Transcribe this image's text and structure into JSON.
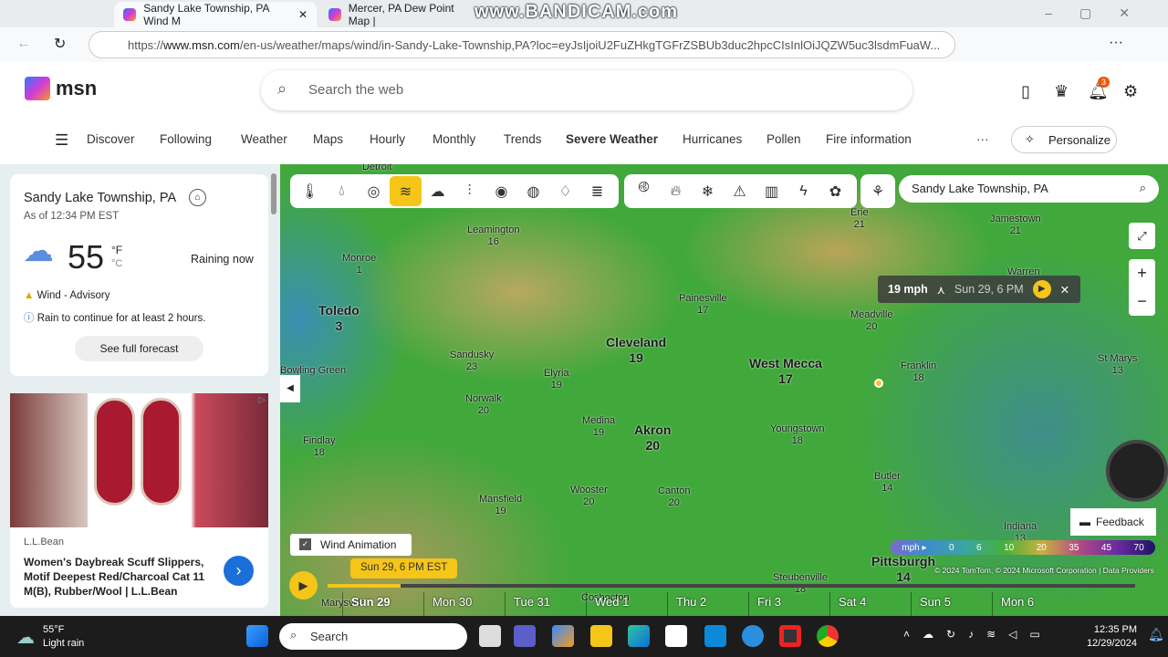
{
  "browser": {
    "tabs": [
      {
        "title": "Sandy Lake Township, PA Wind M"
      },
      {
        "title": "Mercer, PA Dew Point Map |"
      }
    ],
    "watermark": "www.BANDICAM.com",
    "url_prefix": "https://",
    "url_host": "www.msn.com",
    "url_rest": "/en-us/weather/maps/wind/in-Sandy-Lake-Township,PA?loc=eyJsIjoiU2FuZHkgTGFrZSBUb3duc2hpcCIsInlOiJQZW5uc3lsdmFuaW..."
  },
  "header": {
    "logo": "msn",
    "search_placeholder": "Search the web",
    "notification_count": "3",
    "nav": [
      "Discover",
      "Following",
      "Weather",
      "Maps",
      "Hourly",
      "Monthly",
      "Trends",
      "Severe Weather",
      "Hurricanes",
      "Pollen",
      "Fire information"
    ],
    "more": "···",
    "personalize": "Personalize"
  },
  "weather_card": {
    "location": "Sandy Lake Township, PA",
    "as_of": "As of 12:34 PM EST",
    "temp": "55",
    "unit_f": "°F",
    "unit_c": "°C",
    "condition": "Raining now",
    "alert": "Wind - Advisory",
    "info": "Rain to continue for at least 2 hours.",
    "forecast_button": "See full forecast"
  },
  "ad": {
    "brand": "L.L.Bean",
    "title": "Women's Daybreak Scuff Slippers, Motif Deepest Red/Charcoal Cat 11 M(B), Rubber/Wool | L.L.Bean"
  },
  "map": {
    "location_search": "Sandy Lake Township, PA",
    "tooltip": {
      "speed": "19 mph",
      "time": "Sun 29, 6 PM"
    },
    "wind_animation": "Wind Animation",
    "current_time": "Sun 29, 6 PM EST",
    "days": [
      "Sun 29",
      "Mon 30",
      "Tue 31",
      "Wed 1",
      "Thu 2",
      "Fri 3",
      "Sat 4",
      "Sun 5",
      "Mon 6"
    ],
    "legend": {
      "unit": "mph ▸",
      "values": [
        "0",
        "6",
        "10",
        "20",
        "35",
        "45",
        "70"
      ]
    },
    "attribution": "© 2024 TomTom, © 2024 Microsoft Corporation | Data Providers",
    "feedback": "Feedback",
    "cities": [
      {
        "name": "Detroit",
        "v": ""
      },
      {
        "name": "Leamington",
        "v": "16"
      },
      {
        "name": "Monroe",
        "v": "1"
      },
      {
        "name": "Toledo",
        "v": "3"
      },
      {
        "name": "Sandusky",
        "v": "23"
      },
      {
        "name": "Elyria",
        "v": "19"
      },
      {
        "name": "Norwalk",
        "v": "20"
      },
      {
        "name": "Cleveland",
        "v": "19"
      },
      {
        "name": "Painesville",
        "v": "17"
      },
      {
        "name": "West Mecca",
        "v": "17"
      },
      {
        "name": "Medina",
        "v": "19"
      },
      {
        "name": "Akron",
        "v": "20"
      },
      {
        "name": "Youngstown",
        "v": "18"
      },
      {
        "name": "Findlay",
        "v": "18"
      },
      {
        "name": "Mansfield",
        "v": "19"
      },
      {
        "name": "Wooster",
        "v": "20"
      },
      {
        "name": "Canton",
        "v": "20"
      },
      {
        "name": "Meadville",
        "v": "20"
      },
      {
        "name": "Franklin",
        "v": "18"
      },
      {
        "name": "Erie",
        "v": "21"
      },
      {
        "name": "Jamestown",
        "v": "21"
      },
      {
        "name": "Warren",
        "v": ""
      },
      {
        "name": "St Marys",
        "v": "13"
      },
      {
        "name": "Butler",
        "v": "14"
      },
      {
        "name": "Indiana",
        "v": "13"
      },
      {
        "name": "Pittsburgh",
        "v": "14"
      },
      {
        "name": "Steubenville",
        "v": "18"
      },
      {
        "name": "Marysville",
        "v": ""
      },
      {
        "name": "Coshocton",
        "v": ""
      },
      {
        "name": "Bowling Green",
        "v": ""
      }
    ]
  },
  "taskbar": {
    "temp": "55°F",
    "condition": "Light rain",
    "search": "Search",
    "time": "12:35 PM",
    "date": "12/29/2024"
  }
}
